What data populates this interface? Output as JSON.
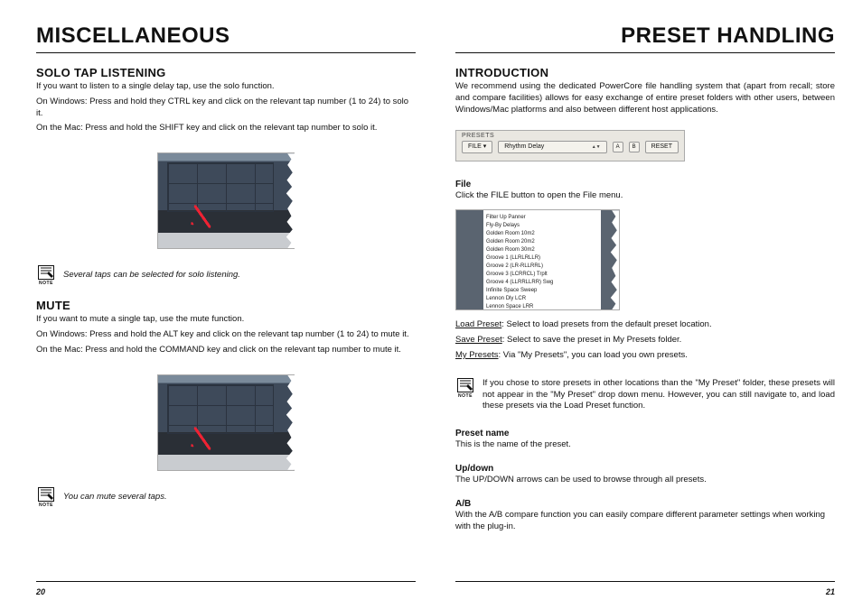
{
  "left": {
    "title": "MISCELLANEOUS",
    "solo": {
      "heading": "SOLO TAP LISTENING",
      "p1": "If you want to listen to a single delay tap, use the solo function.",
      "p2": "On Windows: Press and hold they CTRL key and click on the relevant tap number (1 to 24) to solo it.",
      "p3": "On the Mac: Press and hold the SHIFT key and click on the relevant tap number to solo it.",
      "note": "Several taps can be selected for solo listening."
    },
    "mute": {
      "heading": "MUTE",
      "p1": "If you want to mute a single tap, use the mute function.",
      "p2": "On Windows: Press and hold the ALT key and click on the relevant tap number (1 to 24) to mute it.",
      "p3": "On the Mac: Press and hold the COMMAND key and click on the relevant tap number to mute it.",
      "note": "You can mute several taps."
    },
    "page": "20"
  },
  "right": {
    "title": "PRESET HANDLING",
    "intro": {
      "heading": "INTRODUCTION",
      "p1": "We recommend using the dedicated PowerCore file handling system that (apart from recall; store and compare facilities) allows for easy exchange of entire preset folders with other users, between Windows/Mac platforms and also between different host applications."
    },
    "presetbar": {
      "label": "PRESETS",
      "file": "FILE ▾",
      "name": "Rhythm Delay",
      "a": "A",
      "b": "B",
      "reset": "RESET"
    },
    "file": {
      "heading": "File",
      "p1": "Click the FILE button to open the File menu.",
      "menu": [
        "Filter Up Panner",
        "Fly-By Delays",
        "Golden Room 10m2",
        "Golden Room 20m2",
        "Golden Room 30m2",
        "Groove 1 (LLRLRLLR)",
        "Groove 2 (LR-RLLRRL)",
        "Groove 3 (LCRRCL) Trplt",
        "Groove 4 (LLRRLLRR) Swg",
        "Infinite Space Sweep",
        "Lennon Dly LCR",
        "Lennon Space LRR"
      ],
      "load_label": "Load Preset",
      "load_text": ": Select to load presets from the default preset location.",
      "save_label": "Save Preset",
      "save_text": ": Select to save the preset in My Presets folder.",
      "my_label": "My Presets",
      "my_text": ": Via \"My Presets\", you can load you own presets.",
      "note": "If you chose to store presets in other locations than the \"My Preset\" folder, these presets will not appear in the \"My Preset\" drop down menu. However, you can still navigate to, and load these presets via the Load Preset function."
    },
    "presetname": {
      "heading": "Preset name",
      "p1": "This is the name of the preset."
    },
    "updown": {
      "heading": "Up/down",
      "p1": "The UP/DOWN arrows can be used to browse through all presets."
    },
    "ab": {
      "heading": "A/B",
      "p1": "With the A/B compare function you can easily compare different parameter settings when working with the plug-in."
    },
    "page": "21"
  },
  "note_label": "NOTE"
}
